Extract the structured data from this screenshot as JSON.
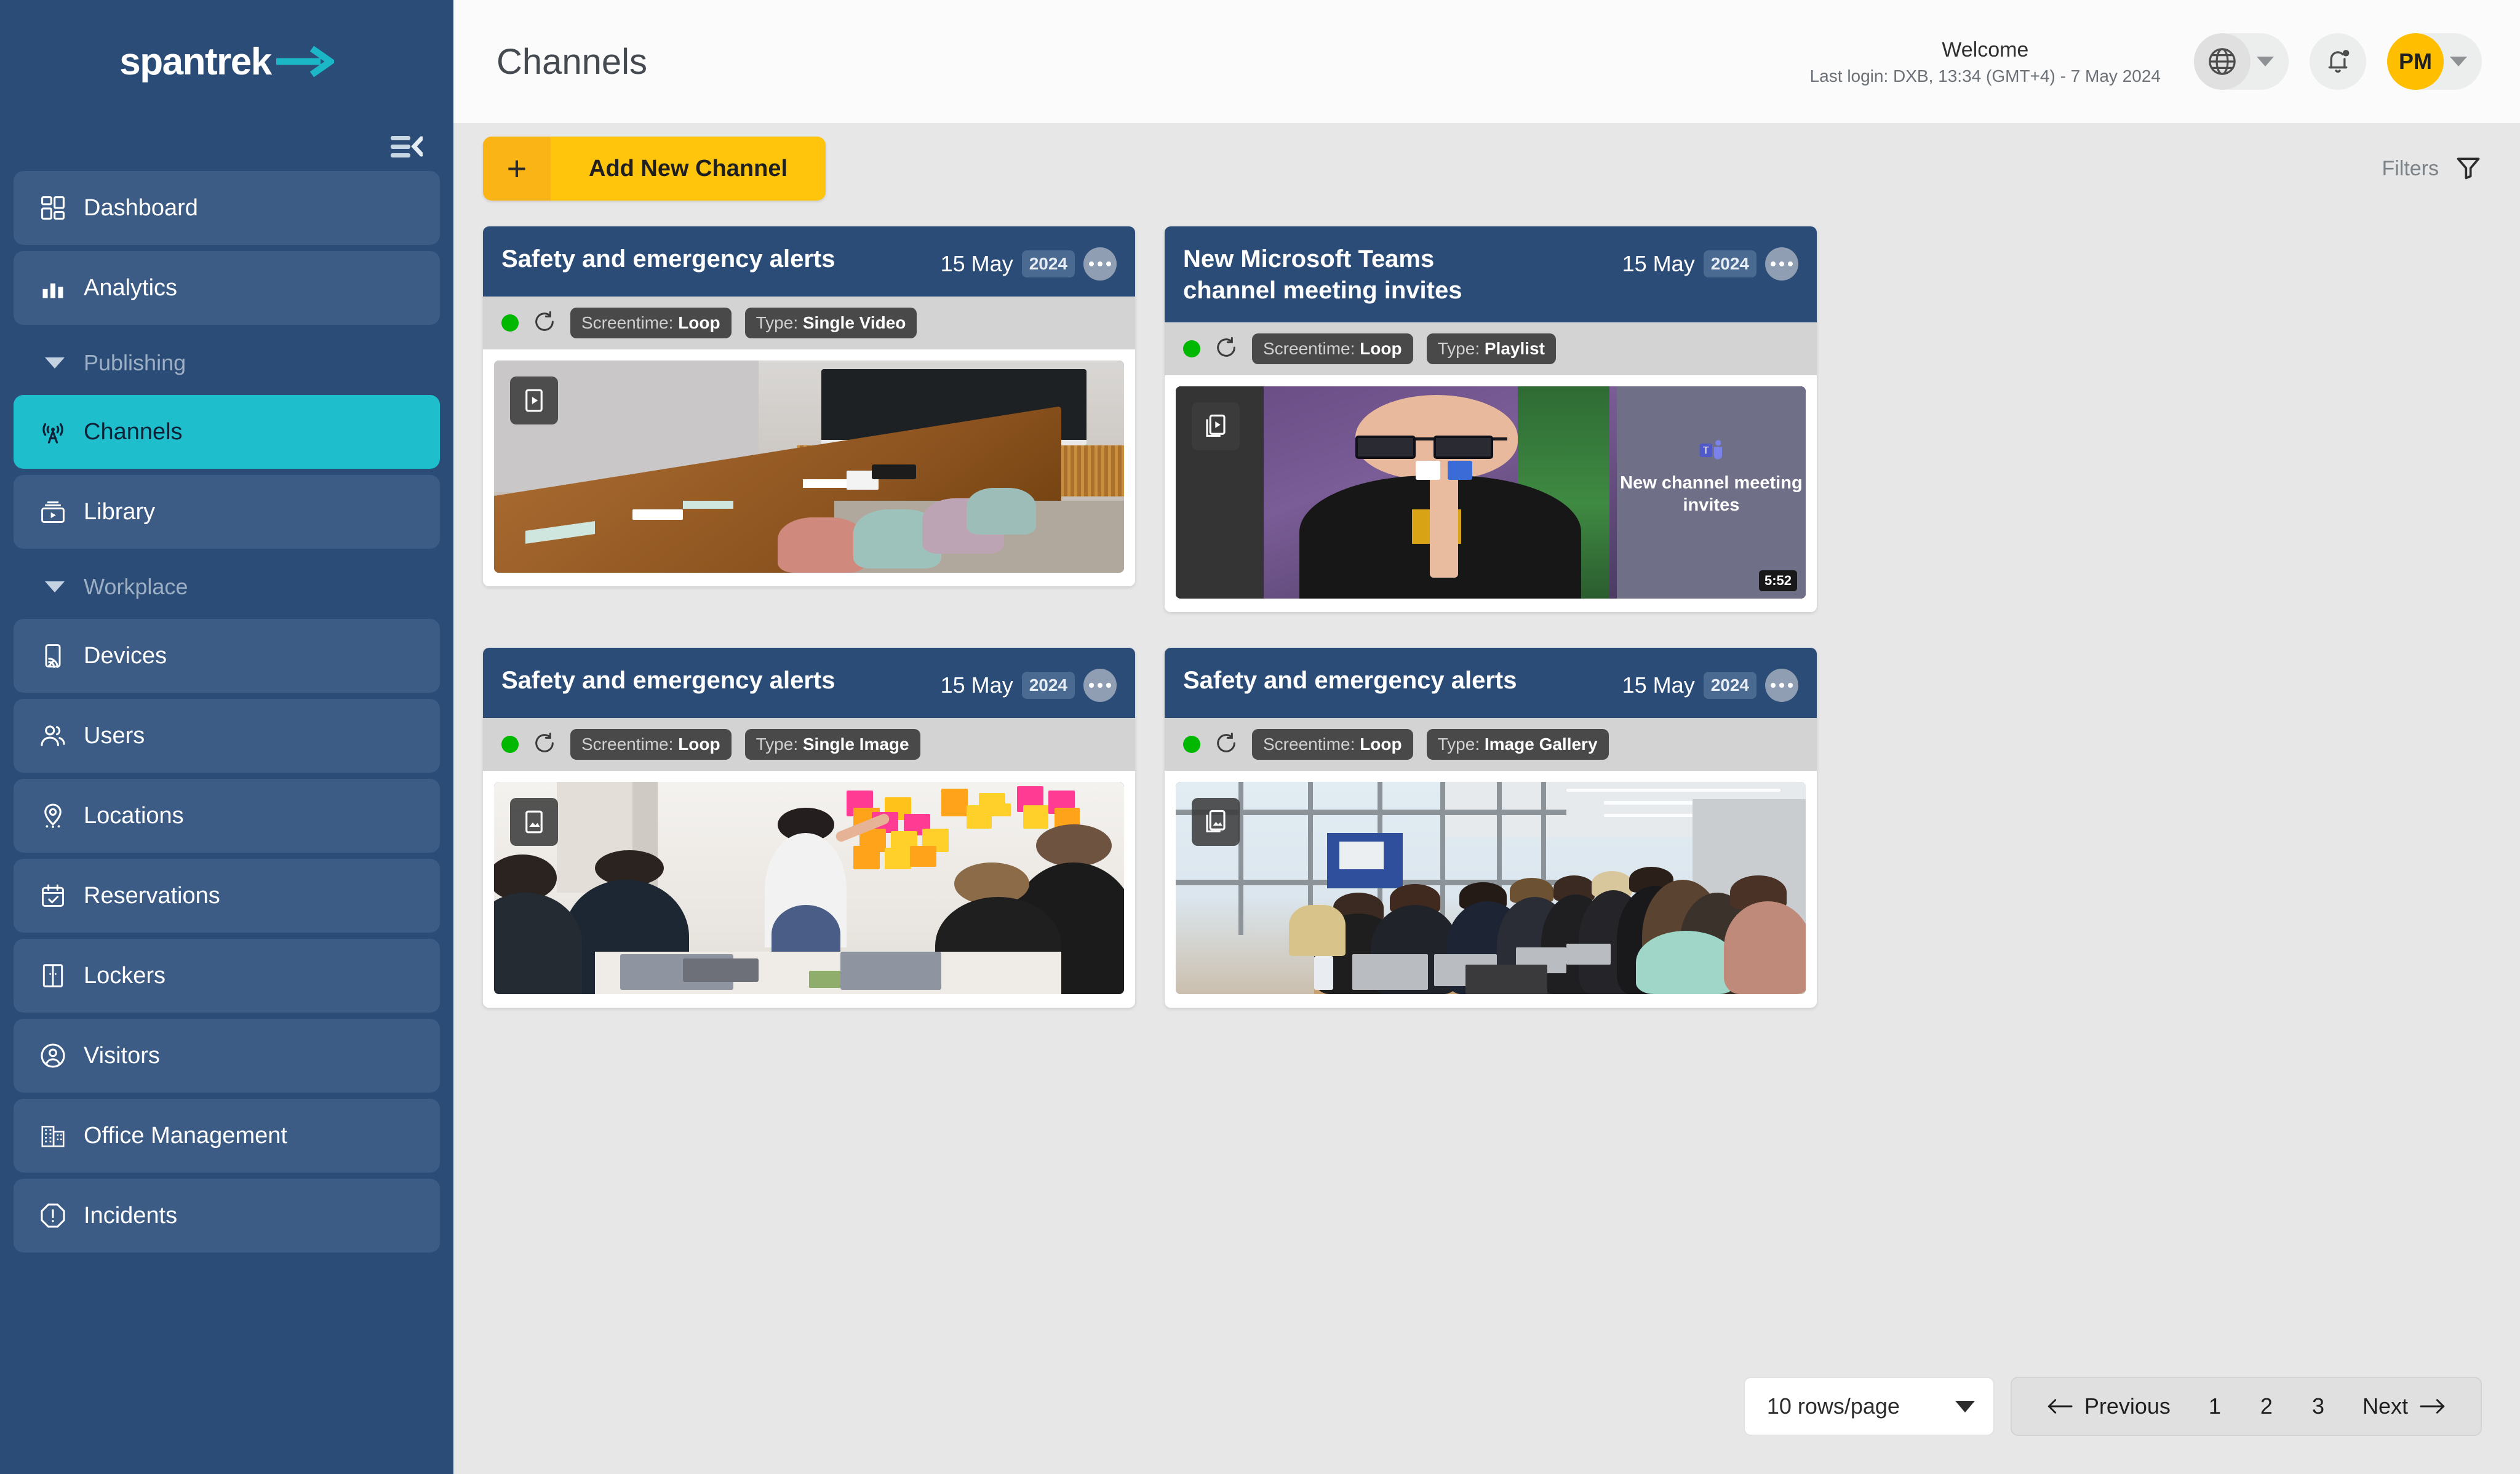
{
  "sidebar": {
    "logo_text": "spantrek",
    "logo_icon": "arrow-right-icon",
    "collapse_icon": "collapse-sidebar-icon",
    "items": [
      {
        "label": "Dashboard",
        "icon": "dashboard-grid-icon",
        "type": "item",
        "active": false
      },
      {
        "label": "Analytics",
        "icon": "bar-chart-icon",
        "type": "item",
        "active": false
      },
      {
        "label": "Publishing",
        "icon": "chevron-down-icon",
        "type": "group"
      },
      {
        "label": "Channels",
        "icon": "broadcast-tower-icon",
        "type": "item",
        "active": true
      },
      {
        "label": "Library",
        "icon": "media-library-icon",
        "type": "item",
        "active": false
      },
      {
        "label": "Workplace",
        "icon": "chevron-down-icon",
        "type": "group"
      },
      {
        "label": "Devices",
        "icon": "device-cast-icon",
        "type": "item",
        "active": false
      },
      {
        "label": "Users",
        "icon": "users-icon",
        "type": "item",
        "active": false
      },
      {
        "label": "Locations",
        "icon": "map-pin-icon",
        "type": "item",
        "active": false
      },
      {
        "label": "Reservations",
        "icon": "calendar-check-icon",
        "type": "item",
        "active": false
      },
      {
        "label": "Lockers",
        "icon": "locker-icon",
        "type": "item",
        "active": false
      },
      {
        "label": "Visitors",
        "icon": "visitor-badge-icon",
        "type": "item",
        "active": false
      },
      {
        "label": "Office Management",
        "icon": "office-building-icon",
        "type": "item",
        "active": false
      },
      {
        "label": "Incidents",
        "icon": "alert-octagon-icon",
        "type": "item",
        "active": false
      }
    ]
  },
  "header": {
    "page_title": "Channels",
    "welcome_title": "Welcome",
    "last_login": "Last login: DXB, 13:34 (GMT+4) - 7 May 2024",
    "language_icon": "globe-icon",
    "notifications_icon": "bell-icon",
    "avatar_initials": "PM"
  },
  "toolbar": {
    "add_button_label": "Add New Channel",
    "add_button_icon": "plus-icon",
    "filters_label": "Filters",
    "filters_icon": "funnel-icon"
  },
  "cards": [
    {
      "title": "Safety and emergency alerts",
      "date": "15 May",
      "year": "2024",
      "status": "online",
      "loop_icon": "loop-refresh-icon",
      "screentime_label": "Screentime:",
      "screentime_value": "Loop",
      "type_label": "Type:",
      "type_value": "Single Video",
      "media_badge_icon": "single-video-icon",
      "scene": "boardroom",
      "duration": ""
    },
    {
      "title": "New Microsoft Teams channel meeting invites",
      "date": "15 May",
      "year": "2024",
      "status": "online",
      "loop_icon": "loop-refresh-icon",
      "screentime_label": "Screentime:",
      "screentime_value": "Loop",
      "type_label": "Type:",
      "type_value": "Playlist",
      "media_badge_icon": "playlist-icon",
      "scene": "teams",
      "overlay_text": "New channel meeting invites",
      "duration": "5:52"
    },
    {
      "title": "Safety and emergency alerts",
      "date": "15 May",
      "year": "2024",
      "status": "online",
      "loop_icon": "loop-refresh-icon",
      "screentime_label": "Screentime:",
      "screentime_value": "Loop",
      "type_label": "Type:",
      "type_value": "Single Image",
      "media_badge_icon": "single-image-icon",
      "scene": "sticky",
      "duration": ""
    },
    {
      "title": "Safety and emergency alerts",
      "date": "15 May",
      "year": "2024",
      "status": "online",
      "loop_icon": "loop-refresh-icon",
      "screentime_label": "Screentime:",
      "screentime_value": "Loop",
      "type_label": "Type:",
      "type_value": "Image Gallery",
      "media_badge_icon": "image-gallery-icon",
      "scene": "glass",
      "duration": ""
    }
  ],
  "footer": {
    "rows_per_page": "10 rows/page",
    "previous_label": "Previous",
    "next_label": "Next",
    "pages": [
      "1",
      "2",
      "3"
    ],
    "prev_icon": "arrow-left-icon",
    "next_icon": "arrow-right-icon"
  },
  "colors": {
    "sidebar_bg": "#2b4c77",
    "accent_teal": "#1fbecd",
    "accent_yellow": "#ffc50c",
    "status_green": "#00b800",
    "card_header_bg": "#2b4c77"
  }
}
